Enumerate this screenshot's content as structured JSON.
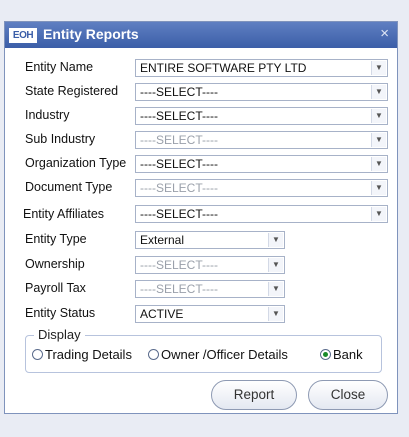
{
  "window": {
    "logo_text": "EOH",
    "title": "Entity Reports",
    "close_glyph": "×"
  },
  "fields": {
    "entity_name": {
      "label": "Entity Name",
      "value": "ENTIRE SOFTWARE PTY LTD"
    },
    "state_registered": {
      "label": "State Registered",
      "value": "----SELECT----"
    },
    "industry": {
      "label": "Industry",
      "value": "----SELECT----"
    },
    "sub_industry": {
      "label": "Sub Industry",
      "value": "----SELECT----"
    },
    "organization_type": {
      "label": "Organization Type",
      "value": "----SELECT----"
    },
    "document_type": {
      "label": "Document Type",
      "value": "----SELECT----"
    },
    "entity_affiliates": {
      "label": "Entity  Affiliates",
      "value": "----SELECT----"
    },
    "entity_type": {
      "label": "Entity Type",
      "value": "External"
    },
    "ownership": {
      "label": "Ownership",
      "value": "----SELECT----"
    },
    "payroll_tax": {
      "label": "Payroll Tax",
      "value": "----SELECT----"
    },
    "entity_status": {
      "label": "Entity Status",
      "value": "ACTIVE"
    }
  },
  "display": {
    "legend": "Display",
    "options": [
      {
        "label": "Trading Details",
        "selected": false
      },
      {
        "label": "Owner /Officer Details",
        "selected": false
      },
      {
        "label": "Bank",
        "selected": true
      }
    ]
  },
  "buttons": {
    "report": "Report",
    "close": "Close"
  },
  "colors": {
    "titlebar": "#4a6db5",
    "radio_selected": "#1a8a2a"
  }
}
